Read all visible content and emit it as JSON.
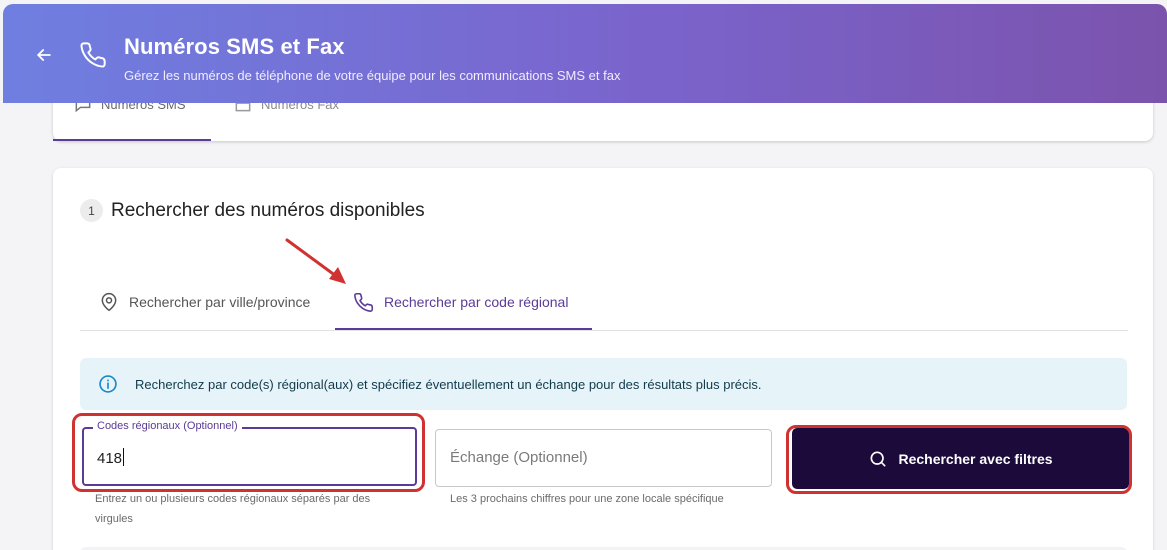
{
  "header": {
    "title": "Numéros SMS et Fax",
    "subtitle": "Gérez les numéros de téléphone de votre équipe pour les communications SMS et fax",
    "back_icon": "arrow-left-icon",
    "title_icon": "phone-icon",
    "gradient_start": "#6f7fe0",
    "gradient_end": "#7b53ad"
  },
  "number_tabs": {
    "items": [
      {
        "label": "Numéros SMS",
        "icon": "message-icon",
        "active": true
      },
      {
        "label": "Numéros Fax",
        "icon": "fax-icon",
        "active": false
      }
    ]
  },
  "search_section": {
    "step": "1",
    "title": "Rechercher des numéros disponibles",
    "mode_tabs": [
      {
        "label": "Rechercher par ville/province",
        "icon": "map-pin-icon",
        "active": false
      },
      {
        "label": "Rechercher par code régional",
        "icon": "phone-icon",
        "active": true
      }
    ],
    "info": "Recherchez par code(s) régional(aux) et spécifiez éventuellement un échange pour des résultats plus précis.",
    "codes_field": {
      "label": "Codes régionaux (Optionnel)",
      "value": "418",
      "helper": "Entrez un ou plusieurs codes régionaux séparés par des virgules"
    },
    "exchange_field": {
      "placeholder": "Échange (Optionnel)",
      "helper": "Les 3 prochains chiffres pour une zone locale spécifique"
    },
    "search_button": {
      "label": "Rechercher avec filtres",
      "icon": "search-icon"
    }
  },
  "colors": {
    "accent": "#5a3b97",
    "button_bg": "#1b0a3a",
    "highlight": "#d03232",
    "info_bg": "#e6f4fa"
  }
}
